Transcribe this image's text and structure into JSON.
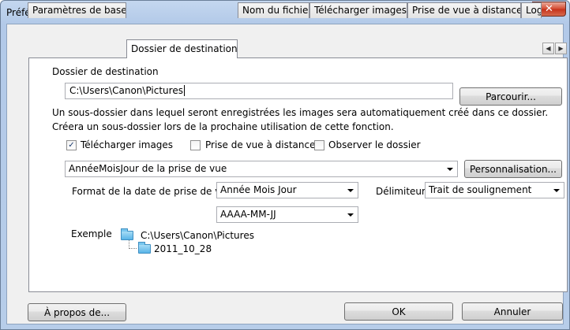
{
  "window": {
    "title": "Préférences",
    "close_icon": "✕"
  },
  "tabs": [
    {
      "label": "Paramètres de base"
    },
    {
      "label": "Dossier de destination"
    },
    {
      "label": "Nom du fichier"
    },
    {
      "label": "Télécharger images"
    },
    {
      "label": "Prise de vue à distance"
    },
    {
      "label": "Log"
    }
  ],
  "tab_scroll": {
    "left": "◀",
    "right": "▶"
  },
  "panel": {
    "section_label": "Dossier de destination",
    "path_value": "C:\\Users\\Canon\\Pictures",
    "browse_button": "Parcourir...",
    "description_line1": "Un sous-dossier dans lequel seront enregistrées les images sera automatiquement créé dans ce dossier.",
    "description_line2": "Créera un sous-dossier lors de la prochaine utilisation de cette fonction.",
    "checkboxes": [
      {
        "label": "Télécharger images",
        "checked": true,
        "mark": "✓"
      },
      {
        "label": "Prise de vue à distance",
        "checked": false,
        "mark": ""
      },
      {
        "label": "Observer le dossier",
        "checked": false,
        "mark": ""
      }
    ],
    "subfolder_combo": "AnnéeMoisJour de la prise de vue",
    "custom_button": "Personnalisation...",
    "date_format_label": "Format de la date de prise de vue",
    "date_format_value": "Année Mois Jour",
    "delimiter_label": "Délimiteur",
    "delimiter_value": "Trait de soulignement",
    "date_pattern_value": "AAAA-MM-JJ",
    "example_label": "Exemple",
    "example_root": "C:\\Users\\Canon\\Pictures",
    "example_sub": "2011_10_28"
  },
  "footer": {
    "about_button": "À propos de...",
    "ok_button": "OK",
    "cancel_button": "Annuler"
  }
}
